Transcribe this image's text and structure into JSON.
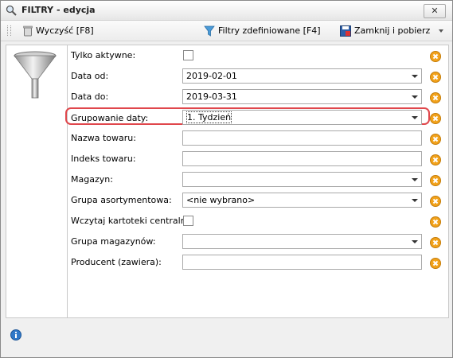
{
  "window": {
    "title": "FILTRY - edycja",
    "close_label": "✕"
  },
  "toolbar": {
    "clear_label": "Wyczyść [F8]",
    "defined_filters_label": "Filtry zdefiniowane [F4]",
    "close_and_fetch_label": "Zamknij i pobierz"
  },
  "form": {
    "rows": [
      {
        "label": "Tylko aktywne:",
        "type": "checkbox",
        "checked": false
      },
      {
        "label": "Data od:",
        "type": "select",
        "value": "2019-02-01"
      },
      {
        "label": "Data do:",
        "type": "select",
        "value": "2019-03-31"
      },
      {
        "label": "Grupowanie daty:",
        "type": "select",
        "value": "1. Tydzień"
      },
      {
        "label": "Nazwa towaru:",
        "type": "text",
        "value": ""
      },
      {
        "label": "Indeks towaru:",
        "type": "text",
        "value": ""
      },
      {
        "label": "Magazyn:",
        "type": "select",
        "value": ""
      },
      {
        "label": "Grupa asortymentowa:",
        "type": "select",
        "value": "<nie wybrano>"
      },
      {
        "label": "Wczytaj kartoteki centralne:",
        "type": "checkbox",
        "checked": false
      },
      {
        "label": "Grupa magazynów:",
        "type": "select",
        "value": ""
      },
      {
        "label": "Producent (zawiera):",
        "type": "text",
        "value": ""
      }
    ]
  },
  "colors": {
    "highlight": "#e0474c",
    "clear_button": "#f2a21b"
  },
  "icons": [
    "search-icon",
    "trash-icon",
    "filter-icon",
    "save-close-icon",
    "funnel-icon",
    "clear-x-icon",
    "info-icon"
  ]
}
